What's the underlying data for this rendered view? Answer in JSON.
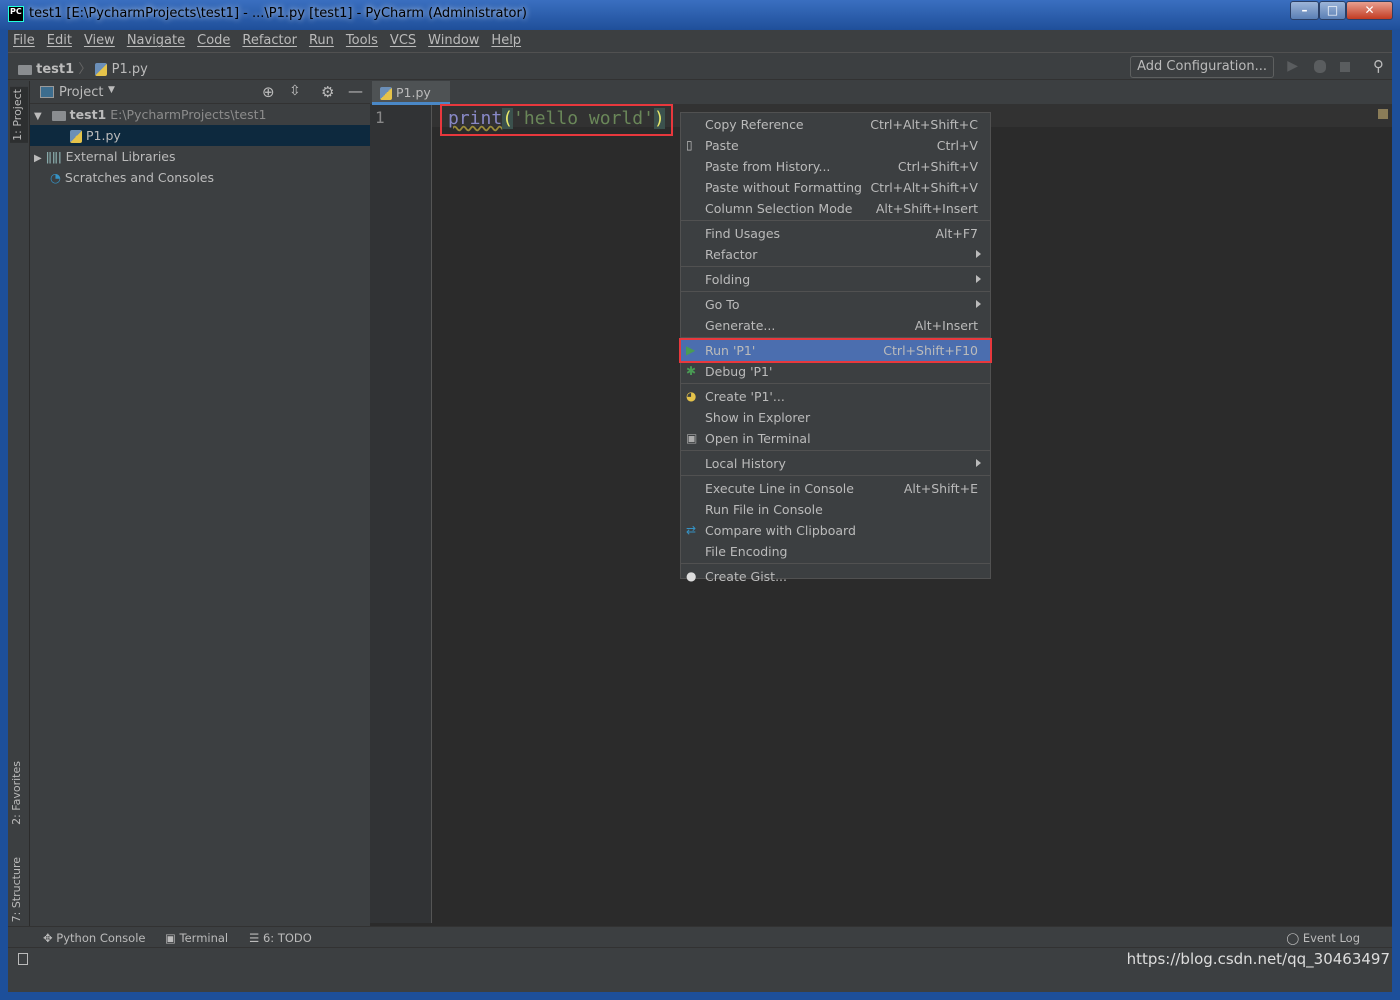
{
  "window": {
    "title": "test1 [E:\\PycharmProjects\\test1] - ...\\P1.py [test1] - PyCharm (Administrator)",
    "app_icon": "PC"
  },
  "menubar": [
    "File",
    "Edit",
    "View",
    "Navigate",
    "Code",
    "Refactor",
    "Run",
    "Tools",
    "VCS",
    "Window",
    "Help"
  ],
  "navbar": {
    "project": "test1",
    "file": "P1.py",
    "add_configuration": "Add Configuration..."
  },
  "left_stripe": {
    "project": "1: Project",
    "favorites": "2: Favorites",
    "structure": "7: Structure"
  },
  "project_panel": {
    "title": "Project",
    "tree": [
      {
        "label": "test1",
        "path": "E:\\PycharmProjects\\test1"
      },
      {
        "label": "P1.py"
      },
      {
        "label": "External Libraries"
      },
      {
        "label": "Scratches and Consoles"
      }
    ]
  },
  "editor": {
    "tab": "P1.py",
    "line_number": "1",
    "code": {
      "func": "print",
      "open": "(",
      "string": "'hello world'",
      "close": ")"
    }
  },
  "context_menu": [
    {
      "label": "Copy Reference",
      "shortcut": "Ctrl+Alt+Shift+C"
    },
    {
      "label": "Paste",
      "shortcut": "Ctrl+V",
      "icon": "clipboard-icon"
    },
    {
      "label": "Paste from History...",
      "shortcut": "Ctrl+Shift+V"
    },
    {
      "label": "Paste without Formatting",
      "shortcut": "Ctrl+Alt+Shift+V"
    },
    {
      "label": "Column Selection Mode",
      "shortcut": "Alt+Shift+Insert",
      "sep_after": true
    },
    {
      "label": "Find Usages",
      "shortcut": "Alt+F7"
    },
    {
      "label": "Refactor",
      "submenu": true,
      "sep_after": true
    },
    {
      "label": "Folding",
      "submenu": true,
      "sep_after": true
    },
    {
      "label": "Go To",
      "submenu": true
    },
    {
      "label": "Generate...",
      "shortcut": "Alt+Insert",
      "sep_after": true
    },
    {
      "label": "Run 'P1'",
      "shortcut": "Ctrl+Shift+F10",
      "icon": "run-icon",
      "selected": true
    },
    {
      "label": "Debug 'P1'",
      "icon": "debug-icon",
      "sep_after": true
    },
    {
      "label": "Create 'P1'...",
      "icon": "python-icon"
    },
    {
      "label": "Show in Explorer"
    },
    {
      "label": "Open in Terminal",
      "icon": "terminal-icon",
      "sep_after": true
    },
    {
      "label": "Local History",
      "submenu": true,
      "sep_after": true
    },
    {
      "label": "Execute Line in Console",
      "shortcut": "Alt+Shift+E"
    },
    {
      "label": "Run File in Console"
    },
    {
      "label": "Compare with Clipboard",
      "icon": "compare-icon"
    },
    {
      "label": "File Encoding",
      "sep_after": true
    },
    {
      "label": "Create Gist...",
      "icon": "github-icon"
    }
  ],
  "bottom_tools": {
    "python_console": "Python Console",
    "terminal": "Terminal",
    "todo": "6: TODO",
    "event_log": "Event Log"
  },
  "watermark": "https://blog.csdn.net/qq_30463497",
  "colors": {
    "accent": "#4b6eaf",
    "highlight_box": "#e8383d",
    "string": "#6a8759",
    "func": "#8888c6"
  }
}
